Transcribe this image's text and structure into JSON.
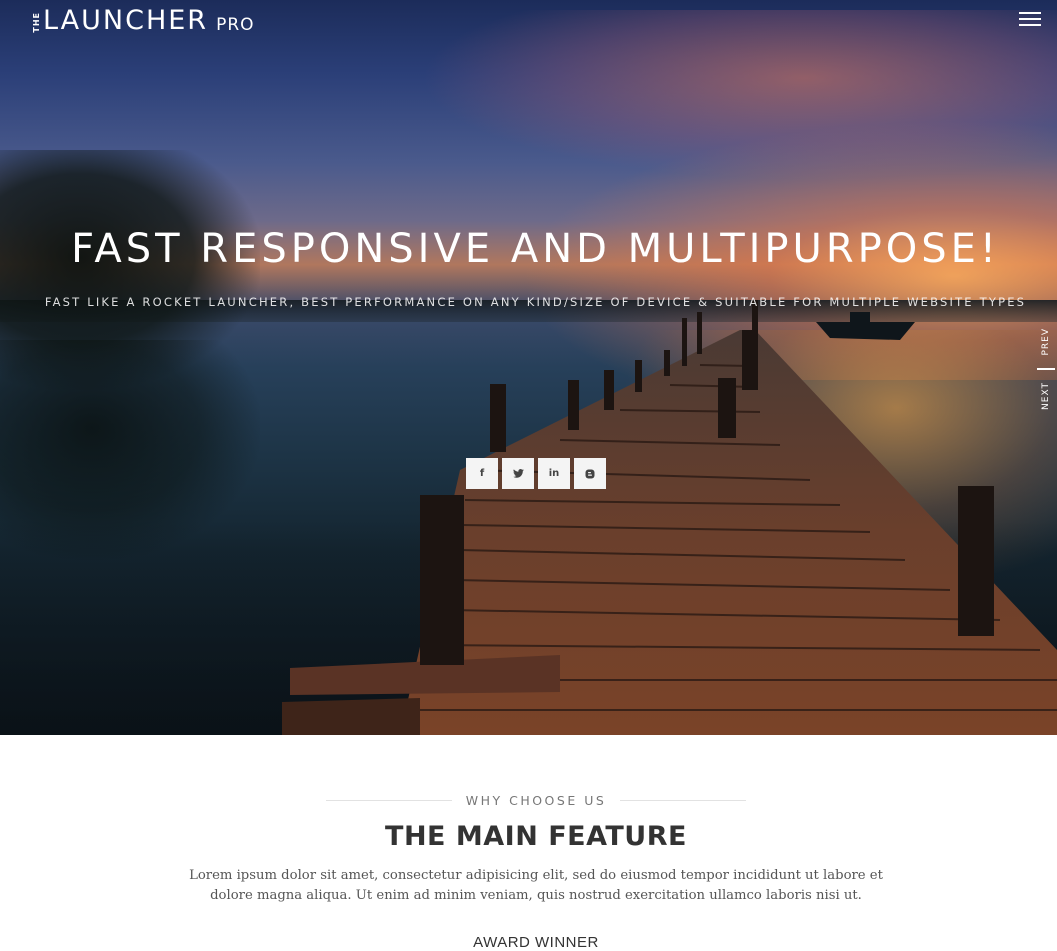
{
  "nav": {
    "logo_the": "THE",
    "logo_main": "LAUNCHER",
    "logo_pro": "PRO",
    "menu_icon": "hamburger-menu-icon"
  },
  "hero": {
    "title": "FAST RESPONSIVE AND MULTIPURPOSE!",
    "subtitle": "FAST LIKE A ROCKET LAUNCHER, BEST PERFORMANCE ON ANY KIND/SIZE OF DEVICE & SUITABLE FOR MULTIPLE WEBSITE TYPES",
    "social": [
      {
        "icon": "facebook-icon",
        "glyph": "f"
      },
      {
        "icon": "twitter-icon",
        "glyph": "t"
      },
      {
        "icon": "linkedin-icon",
        "glyph": "in"
      },
      {
        "icon": "blogger-icon",
        "glyph": "B"
      }
    ],
    "side_nav": {
      "prev": "PREV",
      "next": "NEXT"
    }
  },
  "feature": {
    "eyebrow": "WHY CHOOSE US",
    "title": "THE MAIN FEATURE",
    "body": "Lorem ipsum dolor sit amet, consectetur adipisicing elit, sed do eiusmod tempor incididunt ut labore et dolore magna aliqua. Ut enim ad minim veniam, quis nostrud exercitation ullamco laboris nisi ut.",
    "award_heading": "AWARD WINNER"
  },
  "colors": {
    "accent": "#ffffff",
    "heading": "#333333",
    "body_text": "#555555",
    "eyebrow": "#777777"
  }
}
